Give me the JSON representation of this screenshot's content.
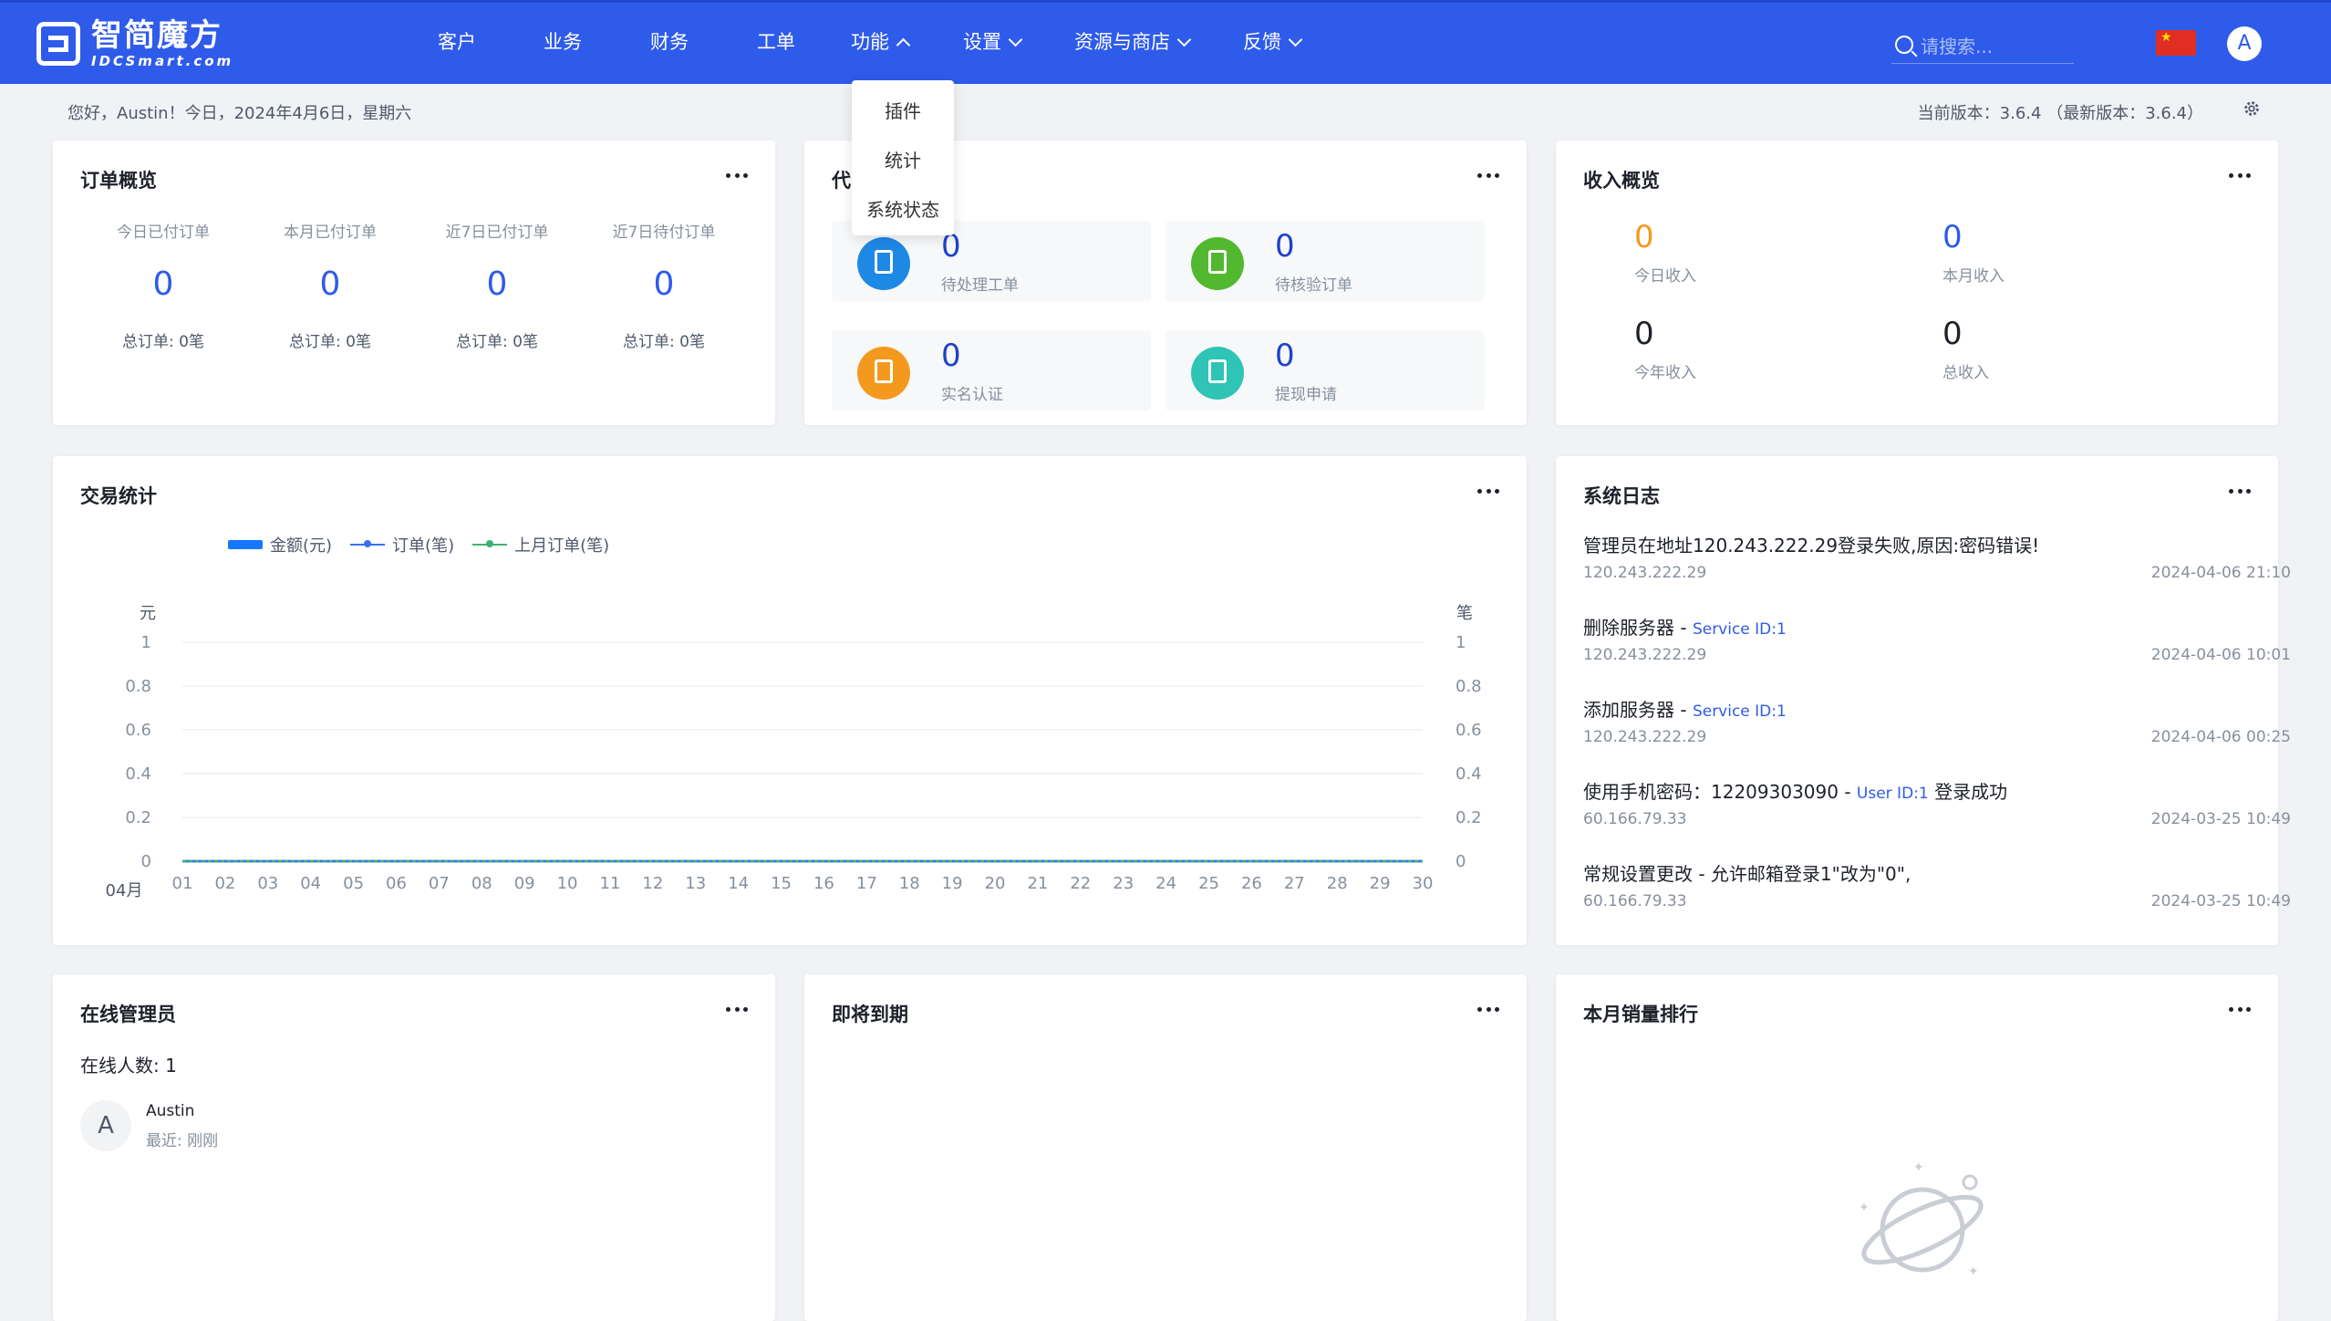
{
  "logo": {
    "cn": "智简魔方",
    "en": "IDCSmart.com"
  },
  "nav": {
    "items": [
      "客户",
      "业务",
      "财务",
      "工单",
      "功能",
      "设置",
      "资源与商店",
      "反馈"
    ],
    "search_placeholder": "请搜索...",
    "avatar_letter": "A"
  },
  "dropdown": {
    "items": [
      "插件",
      "统计",
      "系统状态"
    ]
  },
  "infobar": {
    "greeting": "您好，Austin！今日，2024年4月6日，星期六",
    "version": "当前版本：3.6.4  （最新版本：3.6.4）"
  },
  "orders": {
    "title": "订单概览",
    "stats": [
      {
        "label": "今日已付订单",
        "value": "0",
        "total": "总订单: 0笔"
      },
      {
        "label": "本月已付订单",
        "value": "0",
        "total": "总订单: 0笔"
      },
      {
        "label": "近7日已付订单",
        "value": "0",
        "total": "总订单: 0笔"
      },
      {
        "label": "近7日待付订单",
        "value": "0",
        "total": "总订单: 0笔"
      }
    ]
  },
  "todo": {
    "title": "代",
    "items": [
      {
        "value": "0",
        "label": "待处理工单",
        "color": "#1e88e5"
      },
      {
        "value": "0",
        "label": "待核验订单",
        "color": "#52b82f"
      },
      {
        "value": "0",
        "label": "实名认证",
        "color": "#f39a1e"
      },
      {
        "value": "0",
        "label": "提现申请",
        "color": "#2ec4b6"
      }
    ]
  },
  "income": {
    "title": "收入概览",
    "items": [
      {
        "value": "0",
        "label": "今日收入",
        "color": "#f39a1e"
      },
      {
        "value": "0",
        "label": "本月收入",
        "color": "#2f5bea"
      },
      {
        "value": "0",
        "label": "今年收入",
        "color": "#1d2129"
      },
      {
        "value": "0",
        "label": "总收入",
        "color": "#1d2129"
      }
    ]
  },
  "trade": {
    "title": "交易统计",
    "legend": [
      "金额(元)",
      "订单(笔)",
      "上月订单(笔)"
    ],
    "month_label": "04月"
  },
  "chart_data": {
    "type": "line",
    "title": "",
    "ylabel_left": "元",
    "ylabel_right": "笔",
    "ylim": [
      0,
      1
    ],
    "yticks": [
      "0",
      "0.2",
      "0.4",
      "0.6",
      "0.8",
      "1"
    ],
    "categories": [
      "01",
      "02",
      "03",
      "04",
      "05",
      "06",
      "07",
      "08",
      "09",
      "10",
      "11",
      "12",
      "13",
      "14",
      "15",
      "16",
      "17",
      "18",
      "19",
      "20",
      "21",
      "22",
      "23",
      "24",
      "25",
      "26",
      "27",
      "28",
      "29",
      "30"
    ],
    "series": [
      {
        "name": "金额(元)",
        "color": "#1677ff",
        "values": [
          0,
          0,
          0,
          0,
          0,
          0,
          0,
          0,
          0,
          0,
          0,
          0,
          0,
          0,
          0,
          0,
          0,
          0,
          0,
          0,
          0,
          0,
          0,
          0,
          0,
          0,
          0,
          0,
          0,
          0
        ]
      },
      {
        "name": "订单(笔)",
        "color": "#3a6ff0",
        "values": [
          0,
          0,
          0,
          0,
          0,
          0,
          0,
          0,
          0,
          0,
          0,
          0,
          0,
          0,
          0,
          0,
          0,
          0,
          0,
          0,
          0,
          0,
          0,
          0,
          0,
          0,
          0,
          0,
          0,
          0
        ]
      },
      {
        "name": "上月订单(笔)",
        "color": "#3cb371",
        "values": [
          0,
          0,
          0,
          0,
          0,
          0,
          0,
          0,
          0,
          0,
          0,
          0,
          0,
          0,
          0,
          0,
          0,
          0,
          0,
          0,
          0,
          0,
          0,
          0,
          0,
          0,
          0,
          0,
          0,
          0
        ]
      }
    ],
    "grid": true,
    "legend_position": "top-left"
  },
  "logs": {
    "title": "系统日志",
    "entries": [
      {
        "msg": "管理员在地址120.243.222.29登录失败,原因:密码错误!",
        "link": "",
        "suffix": "",
        "ip": "120.243.222.29",
        "time": "2024-04-06 21:10"
      },
      {
        "msg": "删除服务器 - ",
        "link": "Service ID:1",
        "suffix": "",
        "ip": "120.243.222.29",
        "time": "2024-04-06 10:01"
      },
      {
        "msg": "添加服务器 - ",
        "link": "Service ID:1",
        "suffix": "",
        "ip": "120.243.222.29",
        "time": "2024-04-06 00:25"
      },
      {
        "msg": "使用手机密码：12209303090 - ",
        "link": "User ID:1",
        "suffix": " 登录成功",
        "ip": "60.166.79.33",
        "time": "2024-03-25 10:49"
      },
      {
        "msg": "常规设置更改 - 允许邮箱登录1\"改为\"0\",",
        "link": "",
        "suffix": "",
        "ip": "60.166.79.33",
        "time": "2024-03-25 10:49"
      }
    ]
  },
  "online": {
    "title": "在线管理员",
    "count": "在线人数: 1",
    "admin": {
      "letter": "A",
      "name": "Austin",
      "last": "最近: 刚刚"
    }
  },
  "expiring": {
    "title": "即将到期"
  },
  "ranking": {
    "title": "本月销量排行"
  }
}
